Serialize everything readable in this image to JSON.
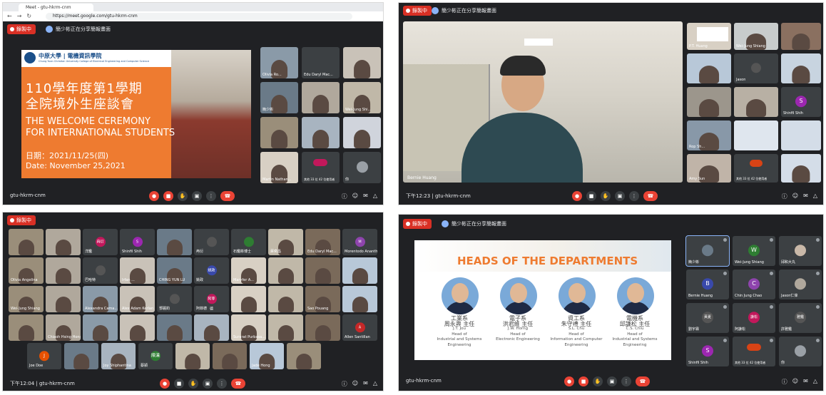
{
  "colors": {
    "meet_dark": "#202124",
    "tile": "#3c4043",
    "red": "#ea4335",
    "orange": "#ee7b30"
  },
  "icons": [
    "mic-icon",
    "camera-icon",
    "raise-hand-icon",
    "present-icon",
    "more-icon",
    "end-call-icon",
    "info-icon",
    "people-icon",
    "chat-icon",
    "activities-icon"
  ],
  "p1": {
    "tab_title": "Meet - gtu-hkrm-cnm",
    "url": "https://meet.google.com/gtu-hkrm-cnm",
    "rec_label": "錄製中",
    "meeting_title": "簡少彬正在分享簡報畫面",
    "meet_code": "gtu-hkrm-cnm",
    "slide": {
      "university": "中原大學 | 電機資訊學院",
      "college_en": "Chung Yuan Christian University College of Electrical Engineering and Computer Science",
      "title_zh_1": "110學年度第1學期",
      "title_zh_2": "全院境外生座談會",
      "title_en_1": "THE WELCOME CEREMONY",
      "title_en_2": "FOR INTERNATIONAL STUDENTS",
      "date_zh": "日期：2021/11/25(四)",
      "date_en": "Date: November 25,2021"
    },
    "tiles": [
      "Olivia Ro...",
      "Edu Daryl Mac...",
      "",
      "簡少彬",
      "",
      "Wei-Jung Shi...",
      "",
      "",
      "",
      "Martin Nathan...",
      "其他 33 位 42 位使用者",
      "你"
    ]
  },
  "p2": {
    "rec_label": "錄製中",
    "meeting_title": "簡少彬正在分享簡報畫面",
    "main_name": "Bernie Huang",
    "time": "下午12:23",
    "meet_code": "gtu-hkrm-cnm",
    "tiles": [
      "P.T. Huang",
      "Wei-Jung Shiang",
      "",
      "",
      "Jason",
      "",
      "",
      "",
      "Shinfil Shih",
      "Rop Sh...",
      "",
      "",
      "Amy Sun",
      "其他 33 位 42 位使用者",
      ""
    ],
    "tile_initial": "S"
  },
  "p3": {
    "rec_label": "錄製中",
    "time": "下午12:04",
    "meet_code": "gtu-hkrm-cnm",
    "grid_names": [
      "",
      "",
      "洋鑑",
      "Shinfil Shih",
      "",
      "冉衍",
      "石鑑彬博士",
      "蔣奕昌",
      "Edu Daryl Mac...",
      "Morentodo Ananth...",
      "Olivia Angelina",
      "",
      "巴哈特",
      "Irfan ...",
      "CHING YUN LU",
      "姚政",
      "Maryfer A...",
      "",
      "",
      "",
      "Wei-Jung Shiang",
      "",
      "Alexandra Cama...",
      "Alex Adam Kerlan",
      "鄧麗鈞",
      "阿菲德",
      "",
      "",
      "Sao Pouang",
      "",
      "",
      "Chiaoh Hsing Hong",
      "",
      "",
      "",
      "",
      "Surarat Purbasa...",
      "",
      "",
      "Allen Santillan"
    ],
    "bottom_names": [
      "Joe Doe",
      "",
      "Joy Shiphantina",
      "蔡潁",
      "",
      "",
      "Jade Hong",
      ""
    ],
    "avatars": {
      "s": "S",
      "m": "M",
      "a": "A",
      "j": "J",
      "lian": "陳漢",
      "zh1": "冉衍",
      "zh2": "姚政",
      "zh3": "阿菲德"
    }
  },
  "p4": {
    "rec_label": "錄製中",
    "meeting_title": "簡少彬正在分享簡報畫面",
    "meet_code": "gtu-hkrm-cnm",
    "slide_heading": "HEADS OF THE DEPARTMENTS",
    "depts": [
      {
        "zh": "工業系",
        "zh_name": "周永燾 主任",
        "en_name": "J.T. Jou",
        "role": "Head of",
        "dept_en": "Industrial and Systems Engineering"
      },
      {
        "zh": "電子系",
        "zh_name": "洪君維 主任",
        "en_name": "J.W. Horng",
        "role": "Head of",
        "dept_en": "Electronic Engineering"
      },
      {
        "zh": "資工系",
        "zh_name": "朱守禮 主任",
        "en_name": "S.L. Chu",
        "role": "Head of",
        "dept_en": "Information and Computer Engineering"
      },
      {
        "zh": "電機系",
        "zh_name": "邱謙松 主任",
        "en_name": "C.S. Chiu",
        "role": "Head of",
        "dept_en": "Industrial and Systems Engineering"
      }
    ],
    "tiles": [
      {
        "name": "簡少彬",
        "initial": ""
      },
      {
        "name": "Wei-Jung Shiang",
        "initial": "W"
      },
      {
        "name": "邱和大丸",
        "initial": ""
      },
      {
        "name": "Bernie Huang",
        "initial": "B"
      },
      {
        "name": "Chin Jung Chao",
        "initial": "C"
      },
      {
        "name": "Jason仁偉",
        "initial": ""
      },
      {
        "name": "劉宇霖",
        "initial": "黃夏"
      },
      {
        "name": "阿謙松",
        "initial": "謙松"
      },
      {
        "name": "許雅鑑",
        "initial": "雅鑑"
      },
      {
        "name": "Shinfil Shih",
        "initial": "S"
      },
      {
        "name": "其他 33 位 42 位使用者",
        "initial": ""
      },
      {
        "name": "你",
        "initial": ""
      }
    ]
  }
}
